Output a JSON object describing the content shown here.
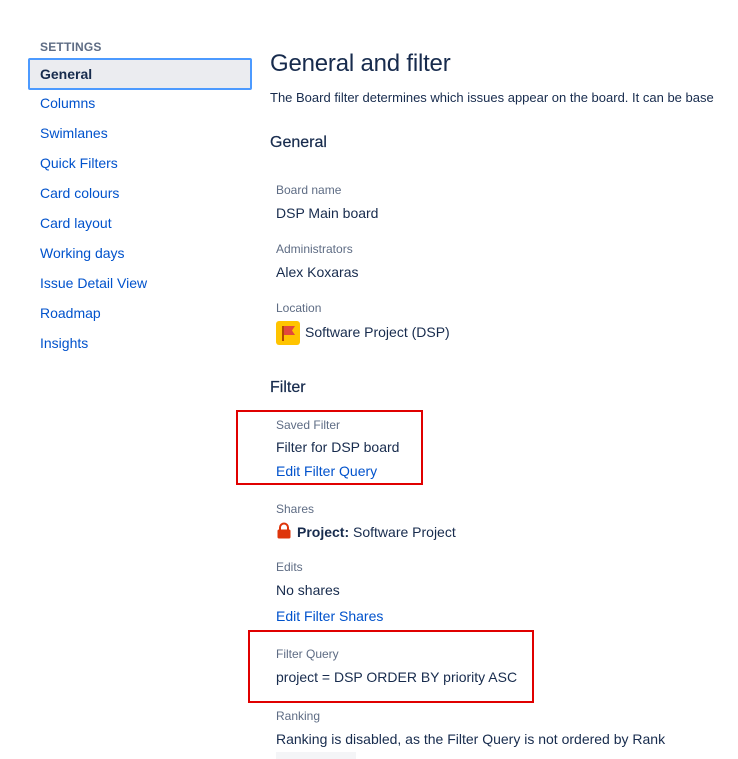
{
  "sidebar": {
    "heading": "SETTINGS",
    "items": [
      {
        "label": "General",
        "active": true
      },
      {
        "label": "Columns"
      },
      {
        "label": "Swimlanes"
      },
      {
        "label": "Quick Filters"
      },
      {
        "label": "Card colours"
      },
      {
        "label": "Card layout"
      },
      {
        "label": "Working days"
      },
      {
        "label": "Issue Detail View"
      },
      {
        "label": "Roadmap"
      },
      {
        "label": "Insights"
      }
    ]
  },
  "main": {
    "title": "General and filter",
    "description": "The Board filter determines which issues appear on the board. It can be base",
    "general": {
      "heading": "General",
      "board_name_label": "Board name",
      "board_name_value": "DSP Main board",
      "administrators_label": "Administrators",
      "administrators_value": "Alex Koxaras",
      "location_label": "Location",
      "location_value": "Software Project (DSP)",
      "location_icon": "project-flag-icon"
    },
    "filter": {
      "heading": "Filter",
      "saved_filter_label": "Saved Filter",
      "saved_filter_value": "Filter for DSP board",
      "edit_filter_query_link": "Edit Filter Query",
      "shares_label": "Shares",
      "shares_prefix": "Project:",
      "shares_value": "Software Project",
      "shares_icon": "lock-icon",
      "edits_label": "Edits",
      "edits_value": "No shares",
      "edit_filter_shares_link": "Edit Filter Shares",
      "filter_query_label": "Filter Query",
      "filter_query_value": "project = DSP ORDER BY priority ASC",
      "ranking_label": "Ranking",
      "ranking_value": "Ranking is disabled, as the Filter Query is not ordered by Rank"
    }
  },
  "colors": {
    "link": "#0052cc",
    "text": "#172b4d",
    "subtle": "#5e6c84",
    "highlight_box": "#e00000",
    "active_border": "#4c9aff",
    "project_icon_bg": "#ffc400",
    "lock_icon": "#de350b"
  }
}
